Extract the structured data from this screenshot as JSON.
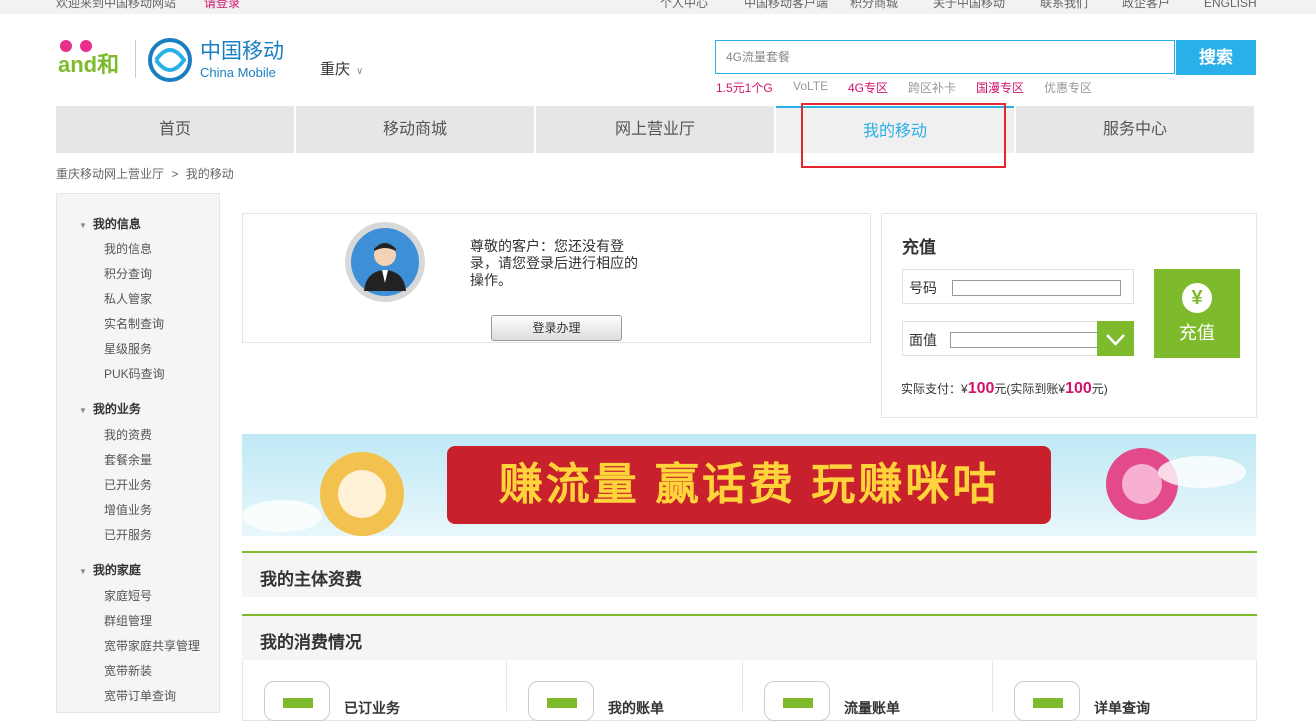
{
  "topbar": {
    "welcome": "欢迎来到中国移动网站",
    "login": "请登录",
    "links": [
      "个人中心",
      "中国移动客户端",
      "积分商城",
      "关于中国移动",
      "联系我们",
      "政企客户",
      "ENGLISH"
    ]
  },
  "header": {
    "brand_he": "and和",
    "brand_cn": "中国移动",
    "brand_en": "China Mobile",
    "city": "重庆",
    "search_placeholder": "4G流量套餐",
    "search_button": "搜索",
    "hot_links": [
      "1.5元1个G",
      "VoLTE",
      "4G专区",
      "跨区补卡",
      "国漫专区",
      "优惠专区"
    ]
  },
  "nav": {
    "tabs": [
      "首页",
      "移动商城",
      "网上营业厅",
      "我的移动",
      "服务中心"
    ],
    "active": "我的移动"
  },
  "breadcrumb": {
    "root": "重庆移动网上营业厅",
    "sep": ">",
    "current": "我的移动"
  },
  "sidebar": {
    "groups": [
      {
        "title": "我的信息",
        "items": [
          "我的信息",
          "积分查询",
          "私人管家",
          "实名制查询",
          "星级服务",
          "PUK码查询"
        ]
      },
      {
        "title": "我的业务",
        "items": [
          "我的资费",
          "套餐余量",
          "已开业务",
          "增值业务",
          "已开服务"
        ]
      },
      {
        "title": "我的家庭",
        "items": [
          "家庭短号",
          "群组管理",
          "宽带家庭共享管理",
          "宽带新装",
          "宽带订单查询"
        ]
      }
    ]
  },
  "login_panel": {
    "message": "尊敬的客户：您还没有登录，请您登录后进行相应的操作。",
    "button": "登录办理"
  },
  "recharge": {
    "title": "充值",
    "number_label": "号码",
    "amount_label": "面值",
    "button": "充值",
    "yen_icon": "¥",
    "pay_prefix": "实际支付：¥",
    "pay_amount": "100",
    "pay_mid": "元(实际到账¥",
    "credit_amount": "100",
    "pay_suffix": "元)"
  },
  "banner": {
    "text": "赚流量 赢话费 玩赚咪咕"
  },
  "sections": {
    "plan": "我的主体资费",
    "consumption": "我的消费情况"
  },
  "consumption_items": [
    "已订业务",
    "我的账单",
    "流量账单",
    "详单查询"
  ],
  "colors": {
    "accent_blue": "#2ab0e8",
    "brand_green": "#7dbb2c",
    "highlight_red": "#e3262f",
    "price_pink": "#d3136b"
  }
}
